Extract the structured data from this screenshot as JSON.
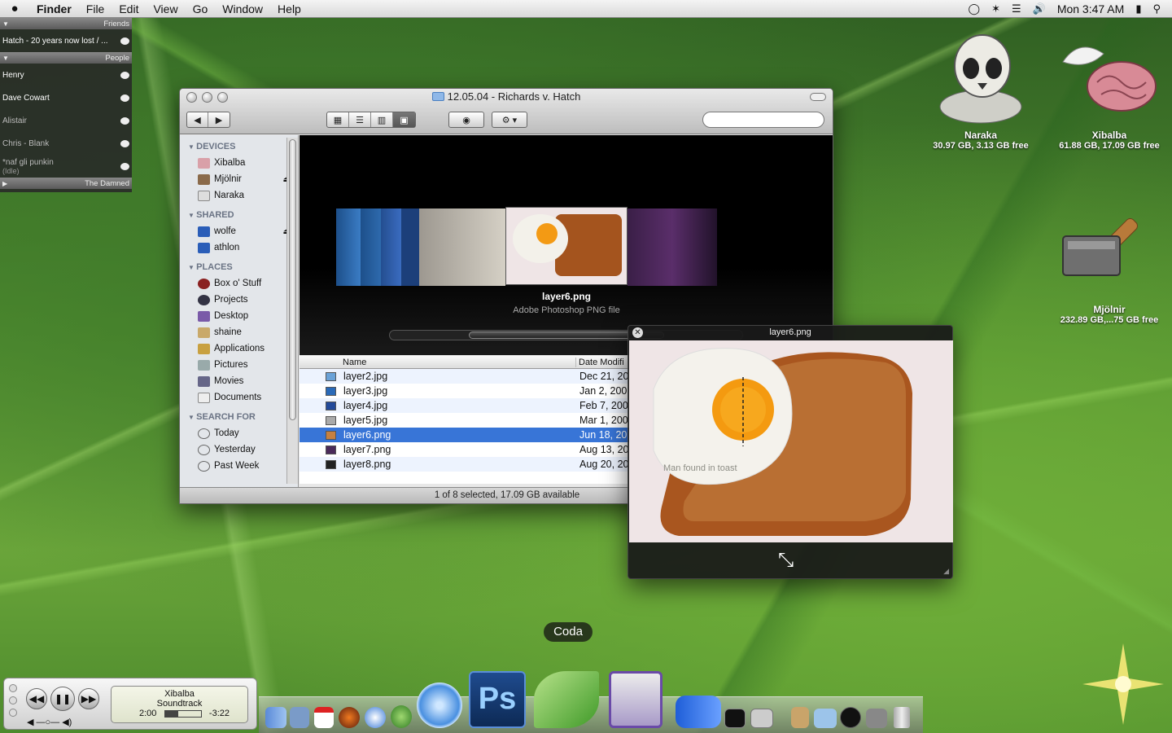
{
  "menubar": {
    "app": "Finder",
    "items": [
      "File",
      "Edit",
      "View",
      "Go",
      "Window",
      "Help"
    ],
    "clock": "Mon 3:47 AM"
  },
  "adium": {
    "groups": [
      {
        "name": "Friends",
        "contacts": [
          {
            "name": "Hatch - 20 years now lost / ..."
          }
        ]
      },
      {
        "name": "People",
        "contacts": [
          {
            "name": "Henry"
          },
          {
            "name": "Dave Cowart"
          },
          {
            "name": "Alistair"
          },
          {
            "name": "Chris - Blank"
          },
          {
            "name": "*naf gli punkin",
            "status": "(Idle)"
          }
        ]
      },
      {
        "name": "The Damned"
      }
    ]
  },
  "finder": {
    "title": "12.05.04 - Richards v. Hatch",
    "search_placeholder": "",
    "sidebar": {
      "devices_header": "DEVICES",
      "devices": [
        "Xibalba",
        "Mjölnir",
        "Naraka"
      ],
      "shared_header": "SHARED",
      "shared": [
        "wolfe",
        "athlon"
      ],
      "places_header": "PLACES",
      "places": [
        "Box o' Stuff",
        "Projects",
        "Desktop",
        "shaine",
        "Applications",
        "Pictures",
        "Movies",
        "Documents"
      ],
      "search_header": "SEARCH FOR",
      "searches": [
        "Today",
        "Yesterday",
        "Past Week"
      ]
    },
    "coverflow": {
      "name": "layer6.png",
      "kind": "Adobe Photoshop PNG file"
    },
    "columns": {
      "name": "Name",
      "date": "Date Modifi"
    },
    "files": [
      {
        "name": "layer2.jpg",
        "date": "Dec 21, 20"
      },
      {
        "name": "layer3.jpg",
        "date": "Jan 2, 200"
      },
      {
        "name": "layer4.jpg",
        "date": "Feb 7, 200"
      },
      {
        "name": "layer5.jpg",
        "date": "Mar 1, 200"
      },
      {
        "name": "layer6.png",
        "date": "Jun 18, 20"
      },
      {
        "name": "layer7.png",
        "date": "Aug 13, 20"
      },
      {
        "name": "layer8.png",
        "date": "Aug 20, 20"
      }
    ],
    "status": "1 of 8 selected, 17.09 GB available"
  },
  "quicklook": {
    "title": "layer6.png",
    "image_caption": "Man found in toast"
  },
  "desktop": [
    {
      "name": "Naraka",
      "info": "30.97 GB, 3.13 GB free"
    },
    {
      "name": "Xibalba",
      "info": "61.88 GB, 17.09 GB free"
    },
    {
      "name": "Mjölnir",
      "info": "232.89 GB,...75 GB free"
    }
  ],
  "itunes": {
    "track": "Xibalba",
    "album": "Soundtrack",
    "elapsed": "2:00",
    "remaining": "-3:22",
    "progress": 0.38
  },
  "dock": {
    "hover_label": "Coda",
    "ps_label": "Ps"
  }
}
